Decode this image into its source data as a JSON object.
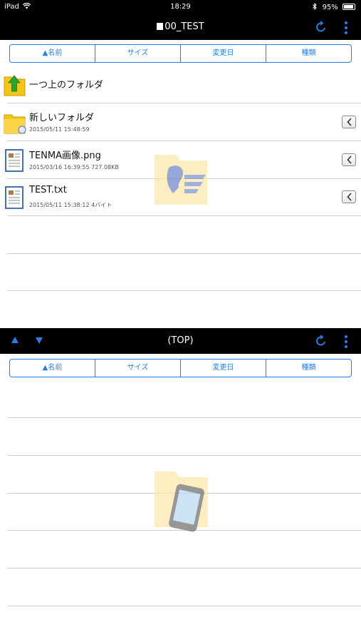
{
  "statusbar": {
    "device": "iPad",
    "time": "18:29",
    "battery": "95%"
  },
  "top_pane": {
    "title": "00_TEST",
    "sort_tabs": [
      "▲名前",
      "サイズ",
      "変更日",
      "種類"
    ],
    "parent_folder_label": "一つ上のフォルダ",
    "items": [
      {
        "name": "新しいフォルダ",
        "meta": "2015/05/11 15:48:59",
        "kind": "folder"
      },
      {
        "name": "TENMA画像.png",
        "meta": "2015/03/16 16:39:55 727.08KB",
        "kind": "file"
      },
      {
        "name": "TEST.txt",
        "meta": "2015/05/11 15:38:12 4バイト",
        "kind": "file"
      }
    ]
  },
  "bottom_pane": {
    "title": "(TOP)",
    "sort_tabs": [
      "▲名前",
      "サイズ",
      "変更日",
      "種類"
    ]
  },
  "colors": {
    "accent": "#2a7de1",
    "bar": "#000000",
    "folder": "#f5c518",
    "up_arrow": "#2aa52a"
  },
  "icons": [
    "wifi-icon",
    "bluetooth-icon",
    "battery-icon",
    "refresh-icon",
    "more-vertical-icon",
    "arrow-up-icon",
    "arrow-down-icon",
    "folder-up-icon",
    "folder-icon",
    "document-icon",
    "chevron-left-icon"
  ]
}
